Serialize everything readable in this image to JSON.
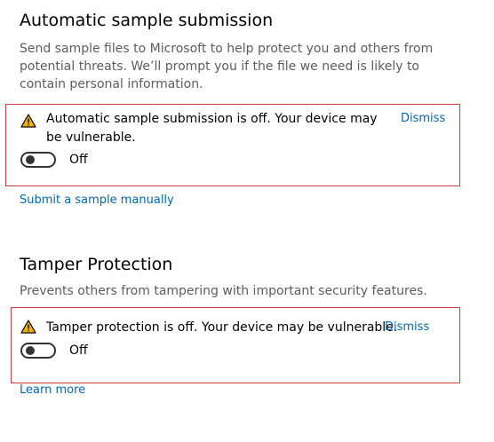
{
  "sample_submission": {
    "title": "Automatic sample submission",
    "description": "Send sample files to Microsoft to help protect you and others from potential threats. We’ll prompt you if the file we need is likely to contain personal information.",
    "warning": {
      "text": "Automatic sample submission is off. Your device may be vulnerable.",
      "dismiss_label": "Dismiss",
      "toggle_state": "Off",
      "toggle_on": false
    },
    "manual_link": "Submit a sample manually"
  },
  "tamper_protection": {
    "title": "Tamper Protection",
    "description": "Prevents others from tampering with important security features.",
    "warning": {
      "text": "Tamper protection is off. Your device may be vulnerable.",
      "dismiss_label": "Dismiss",
      "toggle_state": "Off",
      "toggle_on": false
    },
    "learn_more_link": "Learn more"
  },
  "colors": {
    "link": "#0067b8",
    "warning_border": "#d83b3b",
    "warning_icon": "#f2b200"
  }
}
